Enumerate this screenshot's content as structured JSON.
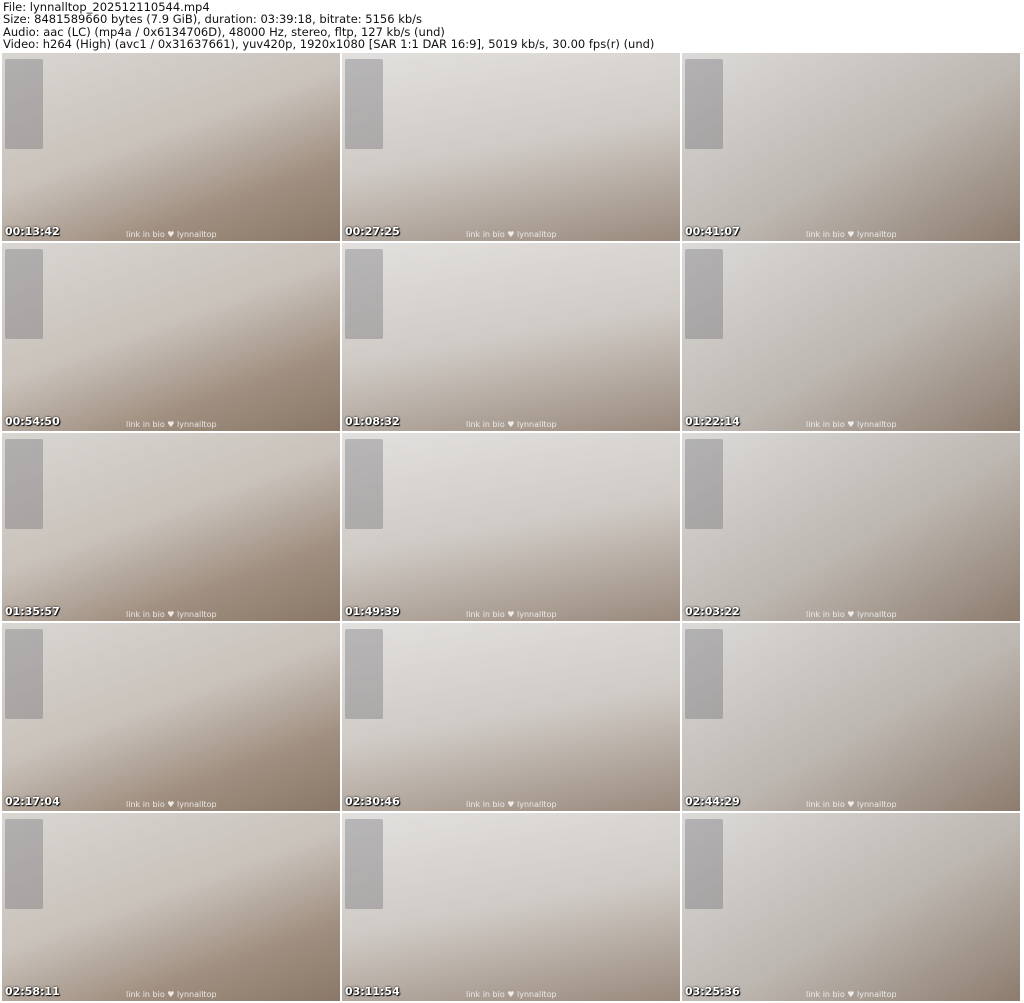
{
  "header": {
    "file": "File: lynnalltop_202512110544.mp4",
    "size": "Size: 8481589660 bytes (7.9 GiB), duration: 03:39:18, bitrate: 5156 kb/s",
    "audio": "Audio: aac (LC) (mp4a / 0x6134706D), 48000 Hz, stereo, fltp, 127 kb/s (und)",
    "video": "Video: h264 (High) (avc1 / 0x31637661), yuv420p, 1920x1080 [SAR 1:1 DAR 16:9], 5019 kb/s, 30.00 fps(r) (und)"
  },
  "watermark": "link in bio ♥ lynnalltop",
  "thumbnails": [
    "00:13:42",
    "00:27:25",
    "00:41:07",
    "00:54:50",
    "01:08:32",
    "01:22:14",
    "01:35:57",
    "01:49:39",
    "02:03:22",
    "02:17:04",
    "02:30:46",
    "02:44:29",
    "02:58:11",
    "03:11:54",
    "03:25:36"
  ]
}
